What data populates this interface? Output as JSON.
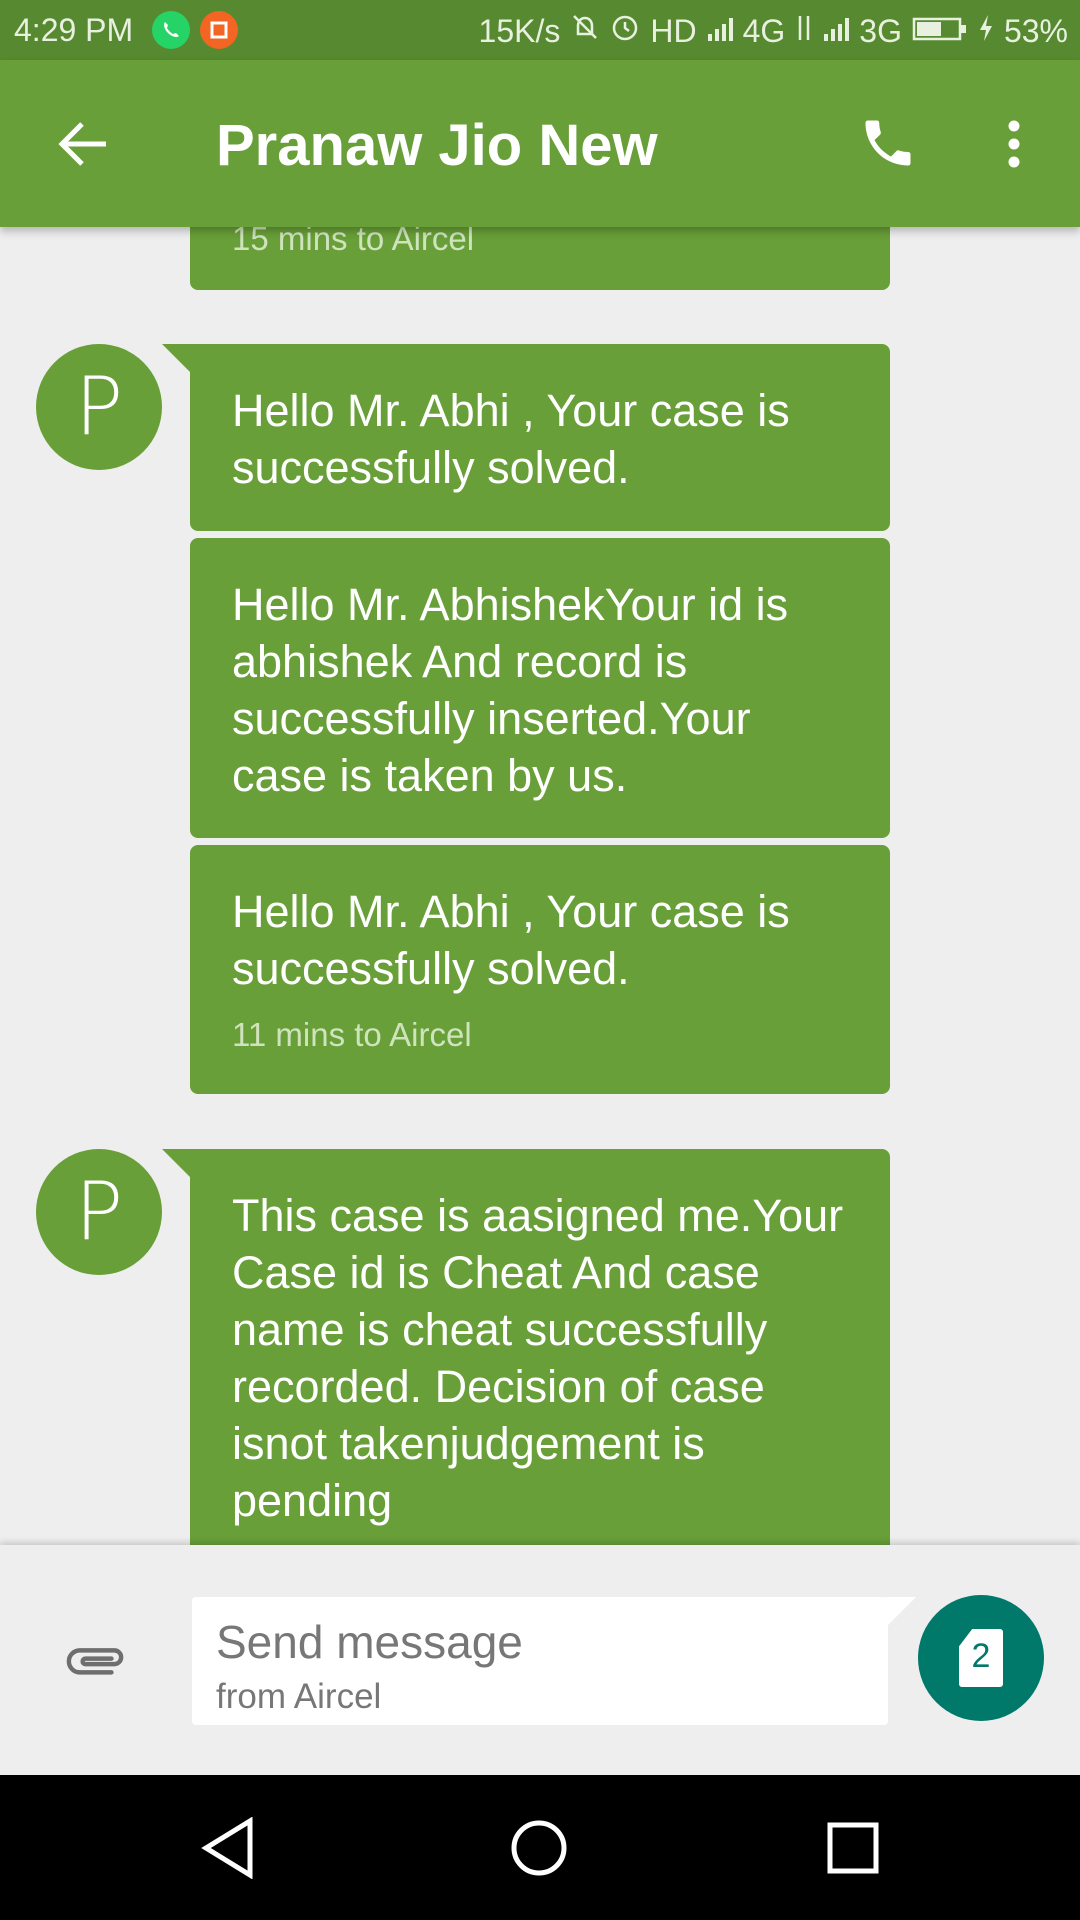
{
  "status_bar": {
    "time": "4:29 PM",
    "network_speed": "15K/s",
    "hd_label": "HD",
    "sim1_type": "4G",
    "sim2_type": "3G",
    "battery": "53%"
  },
  "header": {
    "contact_name": "Pranaw Jio New",
    "icons": [
      "back-arrow-icon",
      "phone-icon",
      "overflow-menu-icon"
    ]
  },
  "messages": [
    {
      "text": "",
      "meta": "15 mins to Aircel"
    },
    {
      "avatar_letter": "P",
      "text": "Hello Mr. Abhi , Your case is successfully solved."
    },
    {
      "text": "Hello Mr. AbhishekYour id is abhishek And  record is successfully inserted.Your case is taken by us."
    },
    {
      "text": "Hello Mr. Abhi , Your case is successfully solved.",
      "meta": "11 mins to Aircel"
    },
    {
      "avatar_letter": "P",
      "text": "This case is aasigned me.Your Case id is Cheat And case name is cheat successfully recorded. Decision of case isnot takenjudgement is pending"
    }
  ],
  "composer": {
    "placeholder": "Send message",
    "sim_hint": "from Aircel",
    "sim_number": "2"
  },
  "colors": {
    "accent": "#689f38",
    "status_bar": "#578a30",
    "send_button": "#00796b"
  }
}
